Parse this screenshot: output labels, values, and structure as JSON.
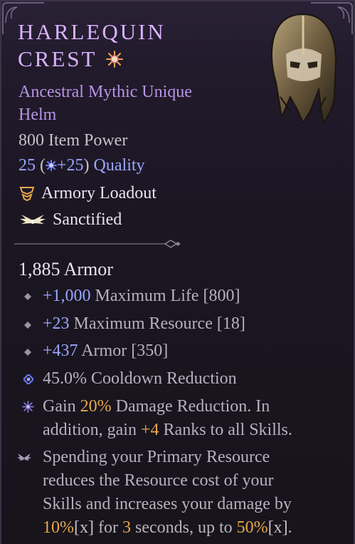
{
  "item": {
    "name_line1": "HARLEQUIN",
    "name_line2": "CREST",
    "rarity_line1": "Ancestral Mythic Unique",
    "rarity_line2": "Helm",
    "item_power": "800 Item Power",
    "quality_base": "25",
    "quality_open": " (",
    "quality_bonus": "+25",
    "quality_close": ")",
    "quality_label": " Quality",
    "tag_loadout": "Armory Loadout",
    "tag_sanctified": "Sanctified",
    "armor": "1,885 Armor",
    "affixes": [
      {
        "value": "+1,000",
        "text": " Maximum Life [800]"
      },
      {
        "value": "+23",
        "text": " Maximum Resource [18]"
      },
      {
        "value": "+437",
        "text": " Armor [350]"
      },
      {
        "value": "",
        "text": "45.0% Cooldown Reduction"
      }
    ],
    "sanctified_affix": {
      "l1_a": "Gain ",
      "l1_b": "20%",
      "l1_c": " Damage Reduction. In",
      "l2_a": "addition, gain ",
      "l2_b": "+4",
      "l2_c": " Ranks to all Skills."
    },
    "unique_power": {
      "l1": "Spending your Primary Resource",
      "l2": "reduces the Resource cost of your",
      "l3": "Skills and increases your damage by",
      "l4_a": "10%",
      "l4_b": "[x]",
      "l4_c": " for ",
      "l4_d": "3",
      "l4_e": " seconds, up to ",
      "l4_f": "50%",
      "l4_g": "[x]",
      "l4_h": "."
    }
  },
  "colors": {
    "title": "#d9b3ff",
    "rarity": "#b894e6",
    "bonus_blue": "#9aa7ff",
    "gold": "#e7a84d",
    "stat_text": "#b7b1bd"
  },
  "icons": {
    "mythic": "mythic-star-icon",
    "loadout": "armory-loadout-icon",
    "sanctified": "sanctified-wings-icon",
    "helm": "helm-icon"
  }
}
